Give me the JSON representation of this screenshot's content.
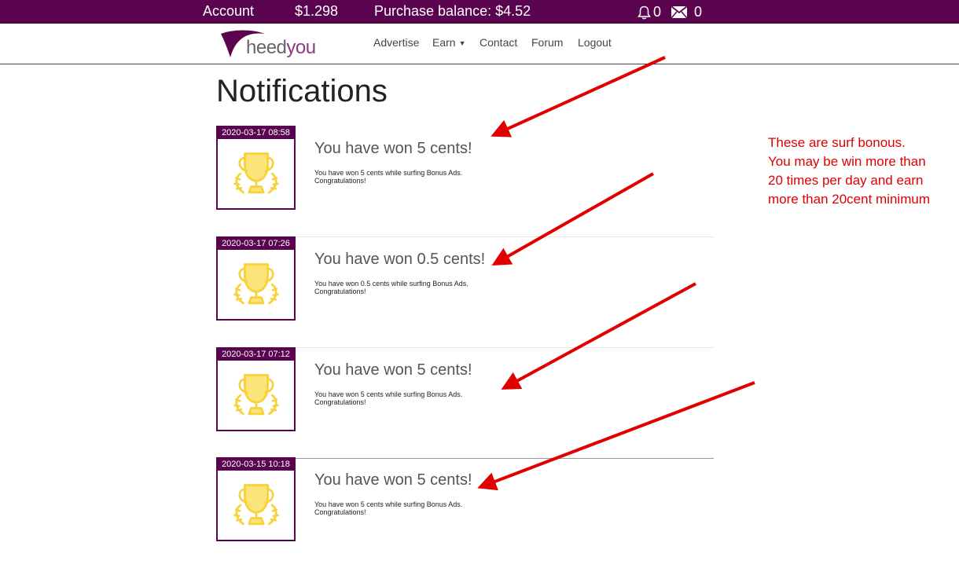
{
  "topbar": {
    "account": "Account",
    "balance": "$1.298",
    "purchase_balance": "Purchase balance: $4.52",
    "notifications_count": "0",
    "messages_count": "0",
    "icons": [
      "bell-icon",
      "mail-icon"
    ]
  },
  "logo": {
    "part1": "heed",
    "part2": "you"
  },
  "nav": {
    "advertise": "Advertise",
    "earn": "Earn",
    "contact": "Contact",
    "forum": "Forum",
    "logout": "Logout"
  },
  "page": {
    "title": "Notifications"
  },
  "notifications": [
    {
      "date": "2020-03-17 08:58",
      "title": "You have won 5 cents!",
      "body_line1": "You have won 5 cents while surfing Bonus Ads.",
      "body_line2": "Congratulations!"
    },
    {
      "date": "2020-03-17 07:26",
      "title": "You have won 0.5 cents!",
      "body_line1": "You have won 0.5 cents while surfing Bonus Ads.",
      "body_line2": "Congratulations!"
    },
    {
      "date": "2020-03-17 07:12",
      "title": "You have won 5 cents!",
      "body_line1": "You have won 5 cents while surfing Bonus Ads.",
      "body_line2": "Congratulations!"
    },
    {
      "date": "2020-03-15 10:18",
      "title": "You have won 5 cents!",
      "body_line1": "You have won 5 cents while surfing Bonus Ads.",
      "body_line2": "Congratulations!"
    }
  ],
  "annotation": {
    "lines": [
      "These are surf bonous.",
      "You may be win more than",
      "20 times per day and earn",
      "more than 20cent minimum"
    ]
  },
  "colors": {
    "brand_purple": "#5a0450",
    "annotation_red": "#e00000",
    "trophy_yellow": "#f7d23a"
  }
}
